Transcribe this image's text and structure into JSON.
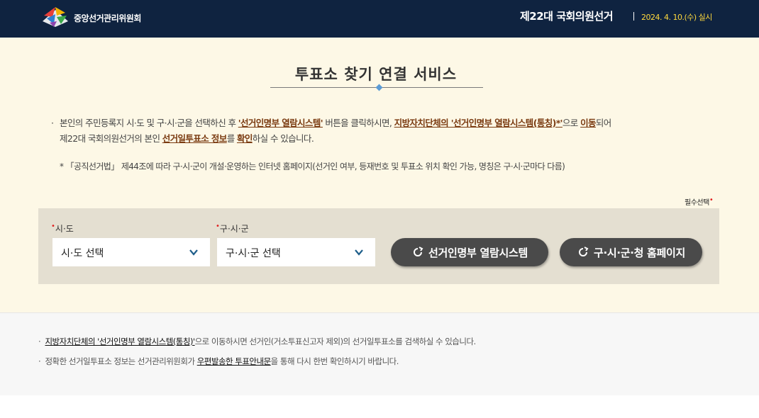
{
  "header": {
    "org_name": "중앙선거관리위원회",
    "election_title": "제22대 국회의원선거",
    "election_date": "2024. 4. 10.(수) 실시"
  },
  "main": {
    "title": "투표소 찾기 연결 서비스",
    "desc": {
      "t1": "본인의 주민등록지 시·도 및 구·시·군을 선택하신 후 ",
      "h1": "'선거인명부 열람시스템'",
      "t2": " 버튼을 클릭하시면, ",
      "h2": "지방자치단체의 '선거인명부 열람시스템(통칭)*'",
      "t3": "으로 ",
      "h3": "이동",
      "t4": "되어",
      "t5": "제22대 국회의원선거의 본인 ",
      "h4": "선거일투표소 정보",
      "t6": "를 ",
      "h5": "확인",
      "t7": "하실 수 있습니다."
    },
    "note": "* 「공직선거법」 제44조에 따라 구·시·군이 개설·운영하는 인터넷 홈페이지(선거인 여부, 등재번호 및 투표소 위치 확인 가능, 명칭은 구·시·군마다 다름)",
    "required_label": "필수선택",
    "sido": {
      "label": "시·도",
      "value": "시·도 선택"
    },
    "gusigun": {
      "label": "구·시·군",
      "value": "구·시·군 선택"
    },
    "btn_register": "선거인명부 열람시스템",
    "btn_homepage": "구·시·군·청 홈페이지"
  },
  "footer": {
    "n1": {
      "u1": "지방자치단체의 '선거인명부 열람시스템(통칭)'",
      "t1": "으로 이동하시면 선거인(거소투표신고자 제외)의 선거일투표소를 검색하실 수 있습니다."
    },
    "n2": {
      "t1": "정확한 선거일투표소 정보는 선거관리위원회가 ",
      "u1": "우편발송한 투표안내문",
      "t2": "을 통해 다시 한번 확인하시기 바랍니다."
    }
  },
  "colors": {
    "header_bg": "#0f2340",
    "date_accent": "#ffd93d",
    "main_bg": "#fdf8e6",
    "highlight": "#7a3a10",
    "panel_bg": "#e4dfd1",
    "button_bg": "#4a4a4a",
    "chevron": "#1f5f8b",
    "required": "#e02020"
  },
  "icons": [
    "nec-logo-icon",
    "chevron-down-icon",
    "external-link-icon"
  ]
}
